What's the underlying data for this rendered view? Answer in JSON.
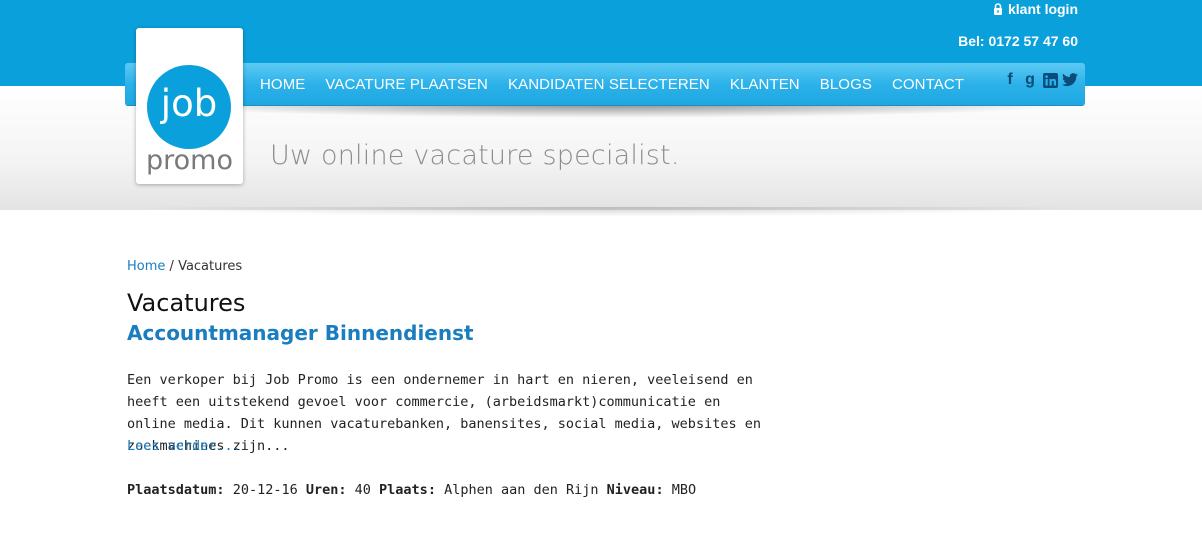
{
  "header": {
    "login_label": "klant login",
    "phone": "Bel: 0172 57 47 60",
    "tagline": "Uw online vacature specialist."
  },
  "logo": {
    "top": "job",
    "bottom": "promo"
  },
  "nav": {
    "items": [
      "HOME",
      "VACATURE PLAATSEN",
      "KANDIDATEN SELECTEREN",
      "KLANTEN",
      "BLOGS",
      "CONTACT"
    ]
  },
  "social": {
    "icons": [
      "facebook-icon",
      "google-plus-icon",
      "linkedin-icon",
      "twitter-icon"
    ],
    "glyphs": [
      "f",
      "g",
      "in",
      "t"
    ]
  },
  "breadcrumb": {
    "home": "Home",
    "separator": "/",
    "current": "Vacatures"
  },
  "page": {
    "title": "Vacatures"
  },
  "job": {
    "title": "Accountmanager Binnendienst",
    "description": "Een verkoper bij Job Promo is een ondernemer in hart en nieren, veeleisend en heeft een uitstekend gevoel voor commercie, (arbeidsmarkt)communicatie en online media. Dit kunnen vacaturebanken, banensites, social media, websites en zoekmachines zijn...",
    "read_more": "Lees verder...",
    "meta": {
      "date_label": "Plaatsdatum:",
      "date": "20-12-16",
      "hours_label": "Uren:",
      "hours": "40",
      "place_label": "Plaats:",
      "place": "Alphen aan den Rijn",
      "level_label": "Niveau:",
      "level": "MBO"
    }
  },
  "colors": {
    "brand": "#0aa0dc",
    "link": "#1a7dc0",
    "nav_bar": "#2cb2ea"
  }
}
